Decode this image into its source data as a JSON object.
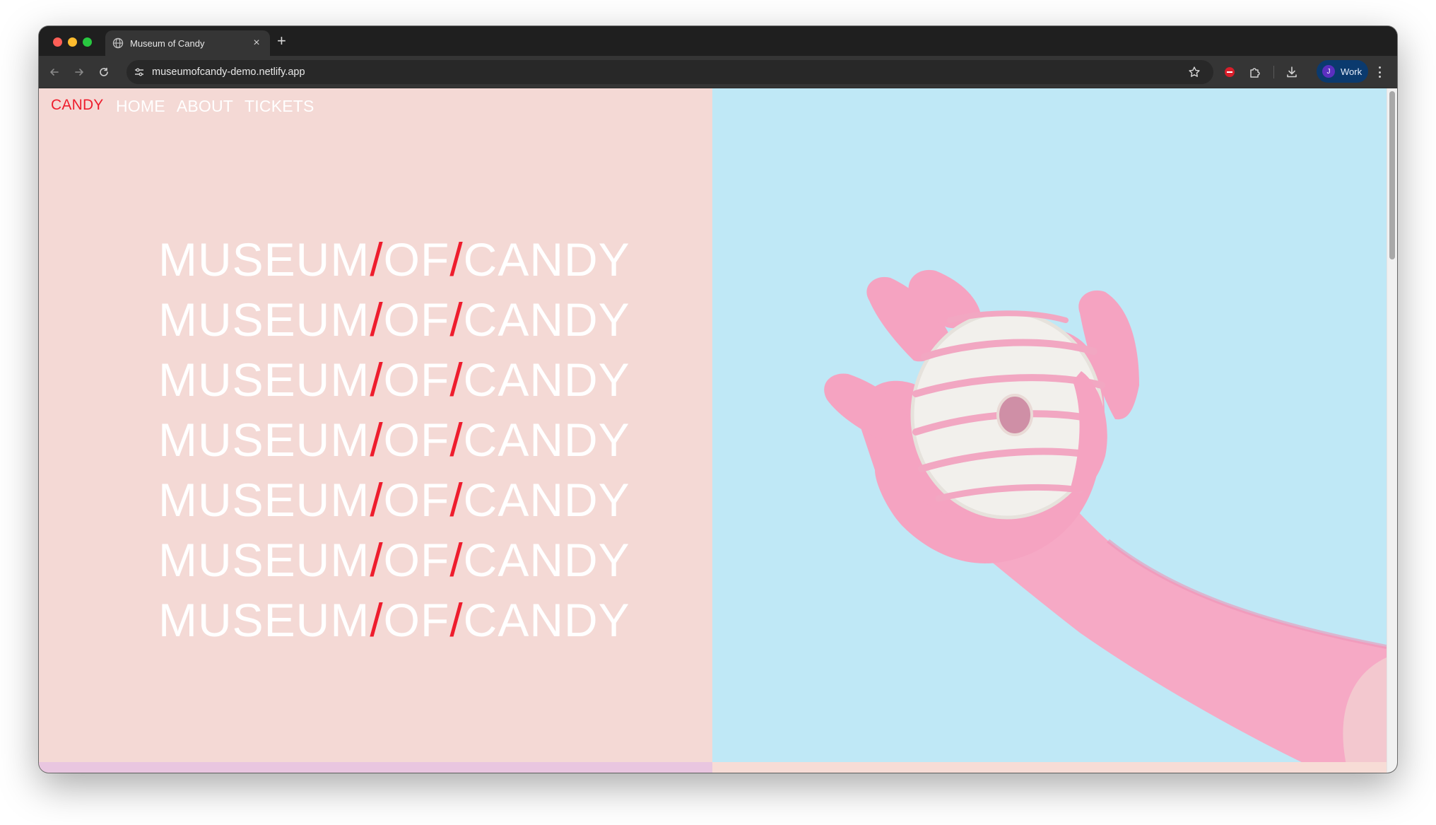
{
  "browser": {
    "tab_title": "Museum of Candy",
    "url": "museumofcandy-demo.netlify.app",
    "profile_initial": "J",
    "profile_name": "Work",
    "traffic_light_colors": [
      "#ff5f57",
      "#febc2e",
      "#28c840"
    ]
  },
  "site": {
    "brand": "CANDY",
    "nav": [
      "HOME",
      "ABOUT",
      "TICKETS"
    ],
    "hero_words": [
      "MUSEUM",
      "OF",
      "CANDY"
    ],
    "hero_separator": "/",
    "colors": {
      "accent": "#ee1d2d",
      "left_panel": "#f4d9d5",
      "right_panel": "#bfe8f6",
      "glove": "#f6a9c5",
      "donut_glaze": "#f2f0ec",
      "donut_stripes": "#f2a7c2"
    }
  }
}
